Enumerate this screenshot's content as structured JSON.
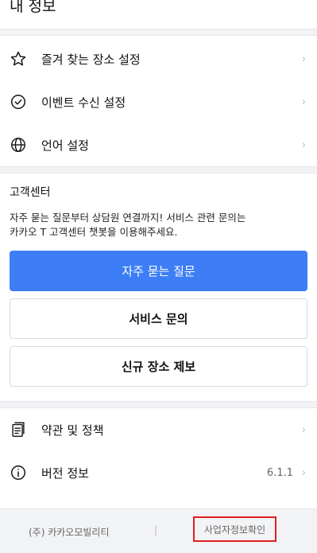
{
  "header": {
    "title": "내 정보"
  },
  "menu_top": [
    {
      "label": "즐겨 찾는 장소 설정",
      "icon": "star-outline-icon"
    },
    {
      "label": "이벤트 수신 설정",
      "icon": "check-circle-icon"
    },
    {
      "label": "언어 설정",
      "icon": "globe-icon"
    }
  ],
  "chevron": "›",
  "customer_center": {
    "title": "고객센터",
    "description_line1": "자주 묻는 질문부터 상담원 연결까지! 서비스 관련 문의는",
    "description_line2": "카카오 T 고객센터 챗봇을 이용해주세요.",
    "faq_button": "자주 묻는 질문",
    "service_inquiry_button": "서비스 문의",
    "new_place_report_button": "신규 장소 제보"
  },
  "menu_bottom": [
    {
      "label": "약관 및 정책",
      "icon": "document-icon"
    },
    {
      "label": "버전 정보",
      "icon": "info-circle-icon",
      "value": "6.1.1"
    }
  ],
  "footer": {
    "company": "(주) 카카오모빌리티",
    "separator": "|",
    "business_info": "사업자정보확인"
  },
  "colors": {
    "primary": "#3d7ef6",
    "highlight_border": "#e01f1f",
    "gap_background": "#f2f3f5"
  }
}
